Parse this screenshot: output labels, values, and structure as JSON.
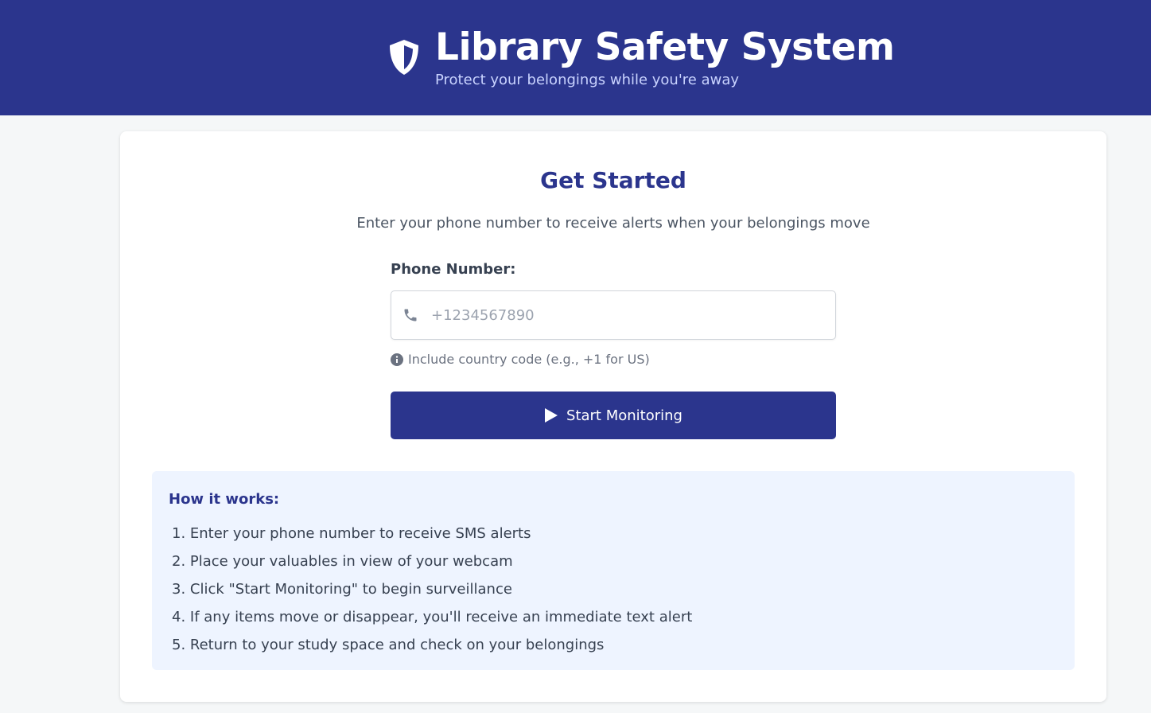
{
  "header": {
    "title": "Library Safety System",
    "subtitle": "Protect your belongings while you're away",
    "icon": "shield-icon",
    "background": "#2b358d"
  },
  "card": {
    "title": "Get Started",
    "description": "Enter your phone number to receive alerts when your belongings move"
  },
  "form": {
    "phone_label": "Phone Number:",
    "phone_placeholder": "+1234567890",
    "phone_value": "",
    "hint": "Include country code (e.g., +1 for US)",
    "submit_label": "Start Monitoring"
  },
  "how_it_works": {
    "title": "How it works:",
    "steps": [
      "1. Enter your phone number to receive SMS alerts",
      "2. Place your valuables in view of your webcam",
      "3. Click \"Start Monitoring\" to begin surveillance",
      "4. If any items move or disappear, you'll receive an immediate text alert",
      "5. Return to your study space and check on your belongings"
    ]
  },
  "colors": {
    "accent": "#2b358d",
    "info_box": "#eef4ff"
  }
}
